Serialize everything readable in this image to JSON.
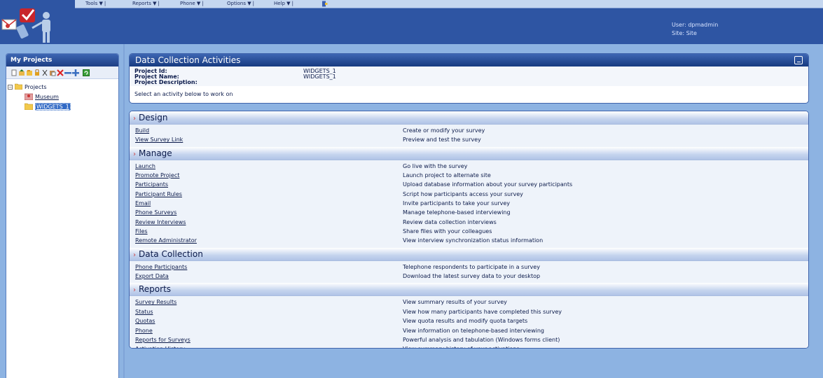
{
  "menu": {
    "items": [
      {
        "label": "Tools ▼",
        "sep": "|"
      },
      {
        "label": "Reports ▼",
        "sep": "|"
      },
      {
        "label": "Phone ▼",
        "sep": "|"
      },
      {
        "label": "Options ▼",
        "sep": "|"
      },
      {
        "label": "Help ▼",
        "sep": "|"
      }
    ],
    "logout_icon": "exit-door-icon"
  },
  "user": {
    "line1": "User: dpmadmin",
    "line2": "Site: Site"
  },
  "left": {
    "title": "My Projects",
    "toolbar_icons": [
      "new-icon",
      "import-icon",
      "copy-icon",
      "lock-icon",
      "cut-icon",
      "paste-icon",
      "delete-icon",
      "collapse-icon",
      "expand-icon",
      "refresh-icon"
    ],
    "tree": {
      "root": "Projects",
      "children": [
        "Museum",
        "WIDGETS_1"
      ]
    }
  },
  "dca": {
    "title": "Data Collection Activities",
    "project_id_label": "Project Id:",
    "project_id": "WIDGETS_1",
    "project_name_label": "Project Name:",
    "project_name": "WIDGETS_1",
    "project_desc_label": "Project Description:",
    "select_text": "Select an activity below to work on"
  },
  "sections": [
    {
      "title": "Design",
      "rows": [
        {
          "link": "Build",
          "desc": "Create or modify your survey"
        },
        {
          "link": "View Survey Link",
          "desc": "Preview and test the survey"
        }
      ]
    },
    {
      "title": "Manage",
      "rows": [
        {
          "link": "Launch",
          "desc": "Go live with the survey"
        },
        {
          "link": "Promote Project",
          "desc": "Launch project to alternate site"
        },
        {
          "link": "Participants",
          "desc": "Upload database information about your survey participants"
        },
        {
          "link": "Participant Rules",
          "desc": "Script how participants access your survey"
        },
        {
          "link": "Email",
          "desc": "Invite participants to take your survey"
        },
        {
          "link": "Phone Surveys",
          "desc": "Manage telephone-based interviewing"
        },
        {
          "link": "Review Interviews",
          "desc": "Review data collection interviews"
        },
        {
          "link": "Files",
          "desc": "Share files with your colleagues"
        },
        {
          "link": "Remote Administrator",
          "desc": "View interview synchronization status information"
        }
      ]
    },
    {
      "title": "Data Collection",
      "rows": [
        {
          "link": "Phone Participants",
          "desc": "Telephone respondents to participate in a survey"
        },
        {
          "link": "Export Data",
          "desc": "Download the latest survey data to your desktop"
        }
      ]
    },
    {
      "title": "Reports",
      "rows": [
        {
          "link": "Survey Results",
          "desc": "View summary results of your survey"
        },
        {
          "link": "Status",
          "desc": "View how many participants have completed this survey"
        },
        {
          "link": "Quotas",
          "desc": "View quota results and modify quota targets"
        },
        {
          "link": "Phone",
          "desc": "View information on telephone-based interviewing"
        },
        {
          "link": "Reports for Surveys",
          "desc": "Powerful analysis and tabulation (Windows forms client)"
        },
        {
          "link": "Activation History",
          "desc": "View summary history of your activations"
        }
      ]
    }
  ]
}
